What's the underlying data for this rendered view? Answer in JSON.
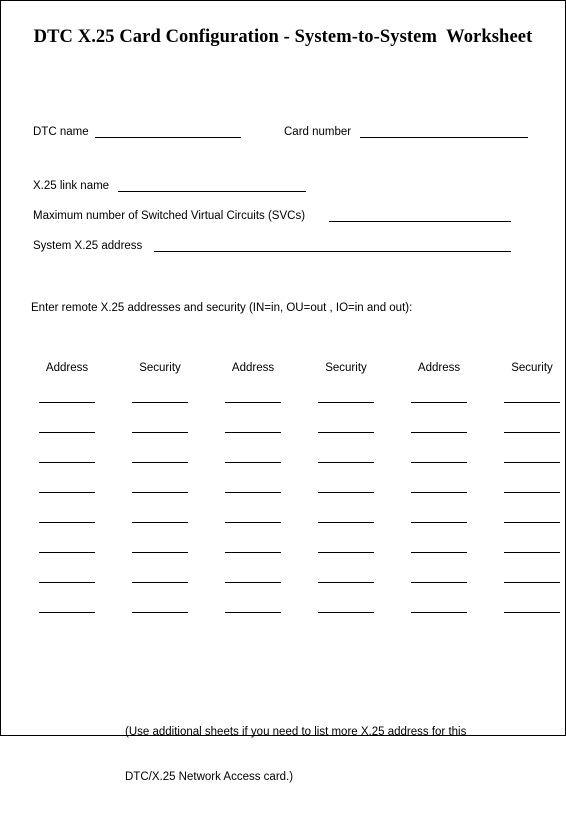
{
  "title": "DTC X.25 Card Configuration - System-to-System  Worksheet",
  "fields": {
    "dtc_name": {
      "label": "DTC name",
      "value": ""
    },
    "card_number": {
      "label": "Card number",
      "value": ""
    },
    "link_name": {
      "label": "X.25 link name",
      "value": ""
    },
    "max_svcs": {
      "label": "Maximum number of Switched Virtual Circuits (SVCs)",
      "value": ""
    },
    "system_address": {
      "label": "System X.25 address",
      "value": ""
    }
  },
  "instructions": "Enter remote X.25 addresses and security (IN=in, OU=out , IO=in and out):",
  "table": {
    "columns": [
      "Address",
      "Security",
      "Address",
      "Security",
      "Address",
      "Security"
    ],
    "row_count": 8
  },
  "footnote": {
    "line1": "(Use additional sheets if you need to list more X.25 address for this",
    "line2": "DTC/X.25 Network Access card.)"
  }
}
